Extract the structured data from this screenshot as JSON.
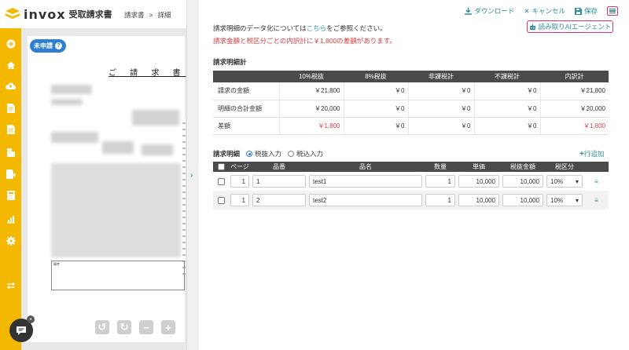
{
  "app": {
    "brand": "invox",
    "product": "受取請求書"
  },
  "breadcrumb": {
    "parent": "請求書",
    "separator": ">",
    "current": "詳細"
  },
  "toolbar": {
    "download": "ダウンロード",
    "cancel": "キャンセル",
    "save": "保存",
    "ai_agent": "読み取りAIエージェント"
  },
  "notice": {
    "line1_prefix": "請求明細のデータ化については",
    "line1_link": "こちら",
    "line1_suffix": "をご参照ください。",
    "line2": "請求金額と税区分ごとの内訳計に￥1,800の差額があります。"
  },
  "document": {
    "status": "未申請",
    "title": "ご 請 求 書",
    "notes_label": "備考"
  },
  "summary": {
    "title": "請求明細計",
    "columns": [
      "",
      "10%税抜",
      "8%税抜",
      "非課税計",
      "不課税計",
      "内訳計"
    ],
    "rows": [
      {
        "label": "請求の金額",
        "values": [
          "￥21,800",
          "￥0",
          "￥0",
          "￥0",
          "￥21,800"
        ]
      },
      {
        "label": "明細の合計金額",
        "values": [
          "￥20,000",
          "￥0",
          "￥0",
          "￥0",
          "￥20,000"
        ]
      },
      {
        "label": "差額",
        "values": [
          "￥1,800",
          "￥0",
          "￥0",
          "￥0",
          "￥1,800"
        ]
      }
    ]
  },
  "details": {
    "title": "請求明細",
    "tax_excluded": "税抜入力",
    "tax_included": "税込入力",
    "add_row": "行追加",
    "columns": [
      "ページ",
      "品番",
      "品名",
      "数量",
      "単価",
      "税抜金額",
      "税区分"
    ],
    "rows": [
      {
        "page": "1",
        "code": "1",
        "name": "test1",
        "qty": "1",
        "unit_price": "10,000",
        "amount": "10,000",
        "tax": "10%"
      },
      {
        "page": "1",
        "code": "2",
        "name": "test2",
        "qty": "1",
        "unit_price": "10,000",
        "amount": "10,000",
        "tax": "10%"
      }
    ]
  },
  "colors": {
    "accent": "#2a8f9c",
    "brand": "#f5b800",
    "warning": "#e03c3c",
    "highlight": "#e0336b",
    "badge": "#2f7fd1"
  }
}
